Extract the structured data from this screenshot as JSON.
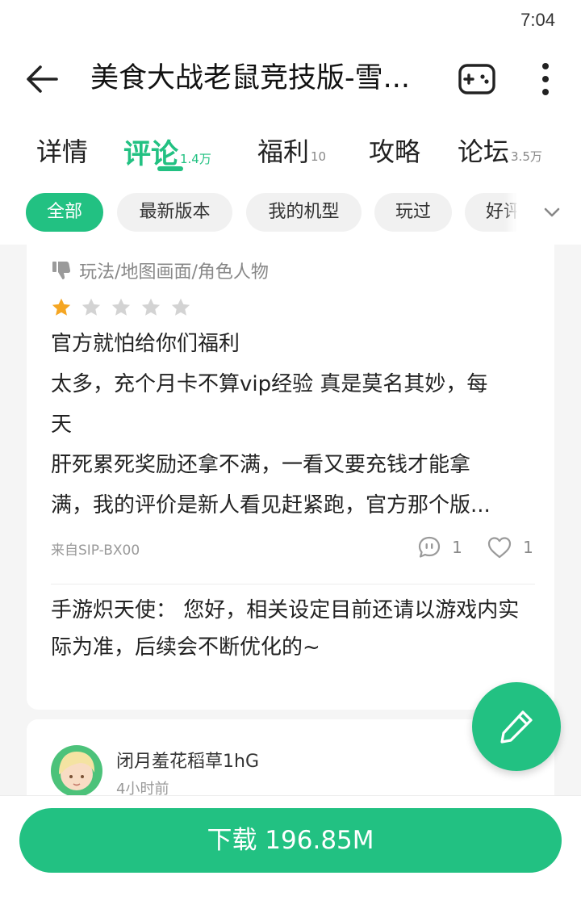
{
  "status_bar": {
    "time": "7:04"
  },
  "header": {
    "title": "美食大战老鼠竞技版-雪..."
  },
  "tabs": [
    {
      "label": "详情",
      "count": ""
    },
    {
      "label": "评论",
      "count": "1.4万",
      "active": true
    },
    {
      "label": "福利",
      "count": "10"
    },
    {
      "label": "攻略",
      "count": ""
    },
    {
      "label": "论坛",
      "count": "3.5万"
    }
  ],
  "filters": [
    {
      "label": "全部",
      "active": true
    },
    {
      "label": "最新版本"
    },
    {
      "label": "我的机型"
    },
    {
      "label": "玩过"
    },
    {
      "label": "好评"
    }
  ],
  "review": {
    "tags": "玩法/地图画面/角色人物",
    "rating": 1,
    "rating_max": 5,
    "text_lines": [
      "官方就怕给你们福利",
      "太多，充个月卡不算vip经验 真是莫名其妙，每",
      "天",
      "肝死累死奖励还拿不满，一看又要充钱才能拿",
      "满，我的评价是新人看见赶紧跑，官方那个版..."
    ],
    "device": "来自SIP-BX00",
    "comment_count": "1",
    "like_count": "1",
    "reply": "手游炽天使： 您好，相关设定目前还请以游戏内实际为准，后续会不断优化的~"
  },
  "next_review": {
    "user_name": "闭月羞花稻草1hG",
    "time": "4小时前"
  },
  "download": {
    "label": "下载 196.85M"
  },
  "colors": {
    "accent": "#22c182",
    "star_active": "#f5a623",
    "star_inactive": "#d3d3d3"
  }
}
